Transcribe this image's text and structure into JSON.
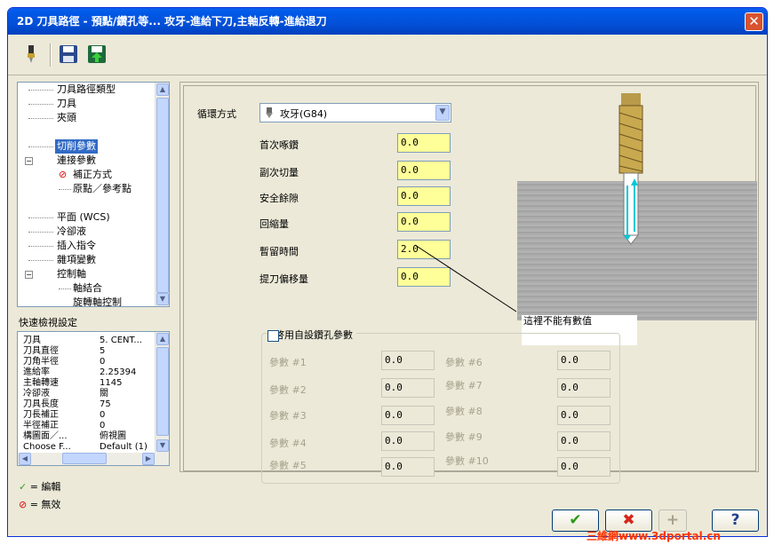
{
  "window": {
    "title": "2D 刀具路徑 - 預點/鑽孔等... 攻牙-進給下刀,主軸反轉-進給退刀",
    "close": "✕"
  },
  "toolbar": {
    "icons": [
      "tool-icon",
      "save-icon",
      "load-icon"
    ]
  },
  "tree": {
    "items": [
      {
        "label": "刀具路徑類型"
      },
      {
        "label": "刀具"
      },
      {
        "label": "夾頭"
      },
      {
        "label": "切削參數"
      },
      {
        "label": "連接參數"
      },
      {
        "label": "補正方式"
      },
      {
        "label": "原點／參考點"
      },
      {
        "label": "平面 (WCS)"
      },
      {
        "label": "冷卻液"
      },
      {
        "label": "插入指令"
      },
      {
        "label": "雜項變數"
      },
      {
        "label": "控制軸"
      },
      {
        "label": "軸結合"
      },
      {
        "label": "旋轉軸控制"
      }
    ]
  },
  "quick": {
    "title": "快速檢視設定",
    "rows": [
      {
        "k": "刀具",
        "v": "5. CENT..."
      },
      {
        "k": "刀具直徑",
        "v": "5"
      },
      {
        "k": "刀角半徑",
        "v": "0"
      },
      {
        "k": "進給率",
        "v": "2.25394"
      },
      {
        "k": "主軸轉速",
        "v": "1145"
      },
      {
        "k": "冷卻液",
        "v": "關"
      },
      {
        "k": "刀具長度",
        "v": "75"
      },
      {
        "k": "刀長補正",
        "v": "0"
      },
      {
        "k": "半徑補正",
        "v": "0"
      },
      {
        "k": "構圖面／...",
        "v": "俯視圖"
      },
      {
        "k": "Choose F...",
        "v": "Default (1)"
      }
    ]
  },
  "legend": {
    "edit": "= 編輯",
    "invalid": "= 無效"
  },
  "form": {
    "cycle_label": "循環方式",
    "cycle_value": "攻牙(G84)",
    "fields": [
      {
        "label": "首次啄鑽",
        "value": "0.0"
      },
      {
        "label": "副次切量",
        "value": "0.0"
      },
      {
        "label": "安全餘隙",
        "value": "0.0"
      },
      {
        "label": "回縮量",
        "value": "0.0"
      },
      {
        "label": "暫留時間",
        "value": "2.0"
      },
      {
        "label": "提刀偏移量",
        "value": "0.0"
      }
    ],
    "callout": "這裡不能有數值",
    "custom_label": "啓用自設鑽孔參數",
    "params_left": [
      {
        "label": "參數 #1",
        "value": "0.0"
      },
      {
        "label": "參數 #2",
        "value": "0.0"
      },
      {
        "label": "參數 #3",
        "value": "0.0"
      },
      {
        "label": "參數 #4",
        "value": "0.0"
      },
      {
        "label": "參數 #5",
        "value": "0.0"
      }
    ],
    "params_right": [
      {
        "label": "參數 #6",
        "value": "0.0"
      },
      {
        "label": "參數 #7",
        "value": "0.0"
      },
      {
        "label": "參數 #8",
        "value": "0.0"
      },
      {
        "label": "參數 #9",
        "value": "0.0"
      },
      {
        "label": "參數 #10",
        "value": "0.0"
      }
    ]
  },
  "buttons": {
    "ok": "✔",
    "cancel": "✖",
    "add": "+",
    "help": "?"
  },
  "watermark": "三維網www.3dportal.cn"
}
